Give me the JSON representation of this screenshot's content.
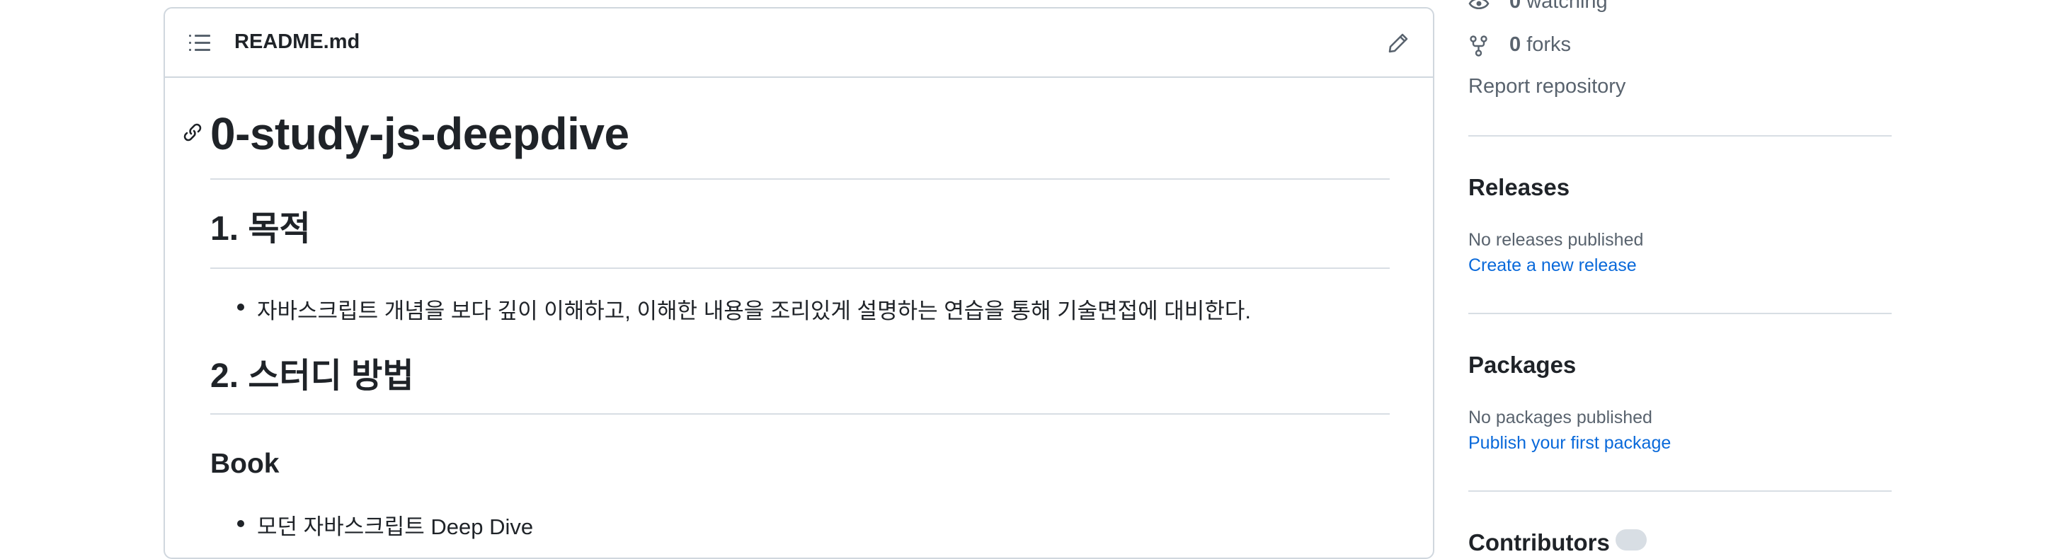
{
  "readme": {
    "filename": "README.md",
    "h1": "0-study-js-deepdive",
    "sections": [
      {
        "heading": "1. 목적",
        "bullets": [
          "자바스크립트 개념을 보다 깊이 이해하고, 이해한 내용을 조리있게 설명하는 연습을 통해 기술면접에 대비한다."
        ]
      },
      {
        "heading": "2. 스터디 방법",
        "subheading": "Book",
        "bullets": [
          "모던 자바스크립트 Deep Dive"
        ]
      }
    ]
  },
  "sidebar": {
    "watching_count": "0",
    "watching_label": "watching",
    "forks_count": "0",
    "forks_label": "forks",
    "report_label": "Report repository",
    "releases": {
      "title": "Releases",
      "empty_text": "No releases published",
      "link": "Create a new release"
    },
    "packages": {
      "title": "Packages",
      "empty_text": "No packages published",
      "link": "Publish your first package"
    },
    "contributors": {
      "title": "Contributors"
    }
  },
  "colors": {
    "text": "#1f2328",
    "muted": "#59636e",
    "link": "#0969da",
    "border": "#d0d7de"
  }
}
